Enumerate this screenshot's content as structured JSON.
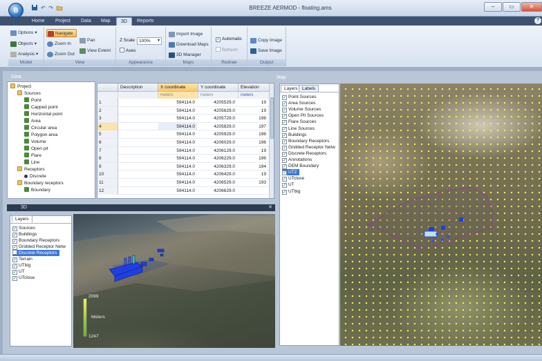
{
  "app": {
    "window_title": "BREEZE AERMOD - floating.ams",
    "orb_label": "B",
    "quick_access": [
      "save-icon",
      "undo-icon",
      "redo-icon",
      "open-icon"
    ]
  },
  "tabs": [
    "Home",
    "Project",
    "Data",
    "Map",
    "3D",
    "Reports"
  ],
  "active_tab": "3D",
  "ribbon": {
    "model": {
      "label": "Model",
      "buttons": [
        "Options",
        "Objects",
        "Analysis"
      ]
    },
    "view": {
      "label": "View",
      "buttons": [
        "Navigate",
        "Zoom In",
        "Zoom Out",
        "Pan",
        "View Extent"
      ]
    },
    "appearance": {
      "label": "Appearance",
      "z_scale_label": "Z Scale",
      "z_scale_value": "100%",
      "axes_label": "Axes"
    },
    "maps": {
      "label": "Maps",
      "buttons": [
        "Import Image",
        "Download Maps",
        "3D Manager"
      ]
    },
    "redraw": {
      "label": "Redraw",
      "automatic_label": "Automatic",
      "refresh_label": "Refresh"
    },
    "output": {
      "label": "Output",
      "buttons": [
        "Copy Image",
        "Save Image"
      ]
    }
  },
  "data_pane": {
    "title": "Data",
    "tree": [
      {
        "label": "Project",
        "indent": 0,
        "icon": "folder"
      },
      {
        "label": "Sources",
        "indent": 1,
        "icon": "folder"
      },
      {
        "label": "Point",
        "indent": 2,
        "icon": "leaf"
      },
      {
        "label": "Capped point",
        "indent": 2,
        "icon": "leaf"
      },
      {
        "label": "Horizontal point",
        "indent": 2,
        "icon": "leaf"
      },
      {
        "label": "Area",
        "indent": 2,
        "icon": "leaf"
      },
      {
        "label": "Circular area",
        "indent": 2,
        "icon": "leaf"
      },
      {
        "label": "Polygon area",
        "indent": 2,
        "icon": "leaf"
      },
      {
        "label": "Volume",
        "indent": 2,
        "icon": "leaf"
      },
      {
        "label": "Open pit",
        "indent": 2,
        "icon": "leaf"
      },
      {
        "label": "Flare",
        "indent": 2,
        "icon": "leaf"
      },
      {
        "label": "Line",
        "indent": 2,
        "icon": "leaf"
      },
      {
        "label": "Receptors",
        "indent": 1,
        "icon": "folder"
      },
      {
        "label": "Discrete",
        "indent": 2,
        "icon": "dot"
      },
      {
        "label": "Boundary receptors",
        "indent": 1,
        "icon": "folder"
      },
      {
        "label": "Boundary",
        "indent": 2,
        "icon": "leaf"
      }
    ],
    "grid": {
      "headers": [
        "",
        "Description",
        "X coordinate",
        "Y coordinate",
        "Elevation"
      ],
      "units": [
        "",
        "",
        "meters",
        "meters",
        "meters"
      ],
      "rows": [
        {
          "n": "1",
          "x": "594114.0",
          "y": "4205529.0",
          "z": "19"
        },
        {
          "n": "2",
          "x": "594114.0",
          "y": "4205629.0",
          "z": "19"
        },
        {
          "n": "3",
          "x": "594114.0",
          "y": "4205729.0",
          "z": "198"
        },
        {
          "n": "4",
          "x": "594114.0",
          "y": "4205829.0",
          "z": "197"
        },
        {
          "n": "5",
          "x": "594114.0",
          "y": "4205929.0",
          "z": "196"
        },
        {
          "n": "6",
          "x": "594114.0",
          "y": "4206029.0",
          "z": "196"
        },
        {
          "n": "7",
          "x": "594114.0",
          "y": "4206129.0",
          "z": "19"
        },
        {
          "n": "8",
          "x": "594114.0",
          "y": "4206229.0",
          "z": "196"
        },
        {
          "n": "9",
          "x": "594114.0",
          "y": "4206329.0",
          "z": "194"
        },
        {
          "n": "10",
          "x": "594114.0",
          "y": "4206429.0",
          "z": "19"
        },
        {
          "n": "11",
          "x": "594114.0",
          "y": "4206529.0",
          "z": "193"
        },
        {
          "n": "12",
          "x": "594114.0",
          "y": "4206629.0",
          "z": ""
        }
      ],
      "selected_row": 3,
      "selected_column": "X coordinate"
    }
  },
  "pane3d": {
    "title": "3D",
    "layers_tab": "Layers",
    "layers": [
      {
        "label": "Sources",
        "checked": true
      },
      {
        "label": "Buildings",
        "checked": true
      },
      {
        "label": "Boundary Receptors",
        "checked": true
      },
      {
        "label": "Gridded Receptor Netw",
        "checked": true
      },
      {
        "label": "Discrete Receptors",
        "checked": false,
        "highlight": true
      },
      {
        "label": "Terrain",
        "checked": true
      },
      {
        "label": "UTbig",
        "checked": true
      },
      {
        "label": "UT",
        "checked": true
      },
      {
        "label": "UTclose",
        "checked": true
      }
    ],
    "legend": {
      "max": "2069",
      "unit": "Meters",
      "min": "1247"
    }
  },
  "map_pane": {
    "title": "Map",
    "tabs": [
      "Layers",
      "Labels"
    ],
    "layers": [
      {
        "label": "Point Sources",
        "checked": true
      },
      {
        "label": "Area Sources",
        "checked": true
      },
      {
        "label": "Volume Sources",
        "checked": true
      },
      {
        "label": "Open Pit Sources",
        "checked": true
      },
      {
        "label": "Flare Sources",
        "checked": true
      },
      {
        "label": "Line Sources",
        "checked": true
      },
      {
        "label": "Buildings",
        "checked": true
      },
      {
        "label": "Boundary Receptors",
        "checked": true
      },
      {
        "label": "Gridded Receptor Netw",
        "checked": true
      },
      {
        "label": "Discrete Receptors",
        "checked": true
      },
      {
        "label": "Annotations",
        "checked": true
      },
      {
        "label": "DEM Boundary",
        "checked": true
      },
      {
        "label": "UT2",
        "checked": true,
        "highlight": true
      },
      {
        "label": "UTclose",
        "checked": true
      },
      {
        "label": "UT",
        "checked": true
      },
      {
        "label": "UTbig",
        "checked": true
      }
    ]
  },
  "colors": {
    "title_bar": "#c9d7ea",
    "tab_strip": "#3f5170",
    "selection": "#3a78d8",
    "receptor_dots": "#f3f05a",
    "boundary": "#9b2fa0",
    "source_blue": "#1f3fe0"
  }
}
